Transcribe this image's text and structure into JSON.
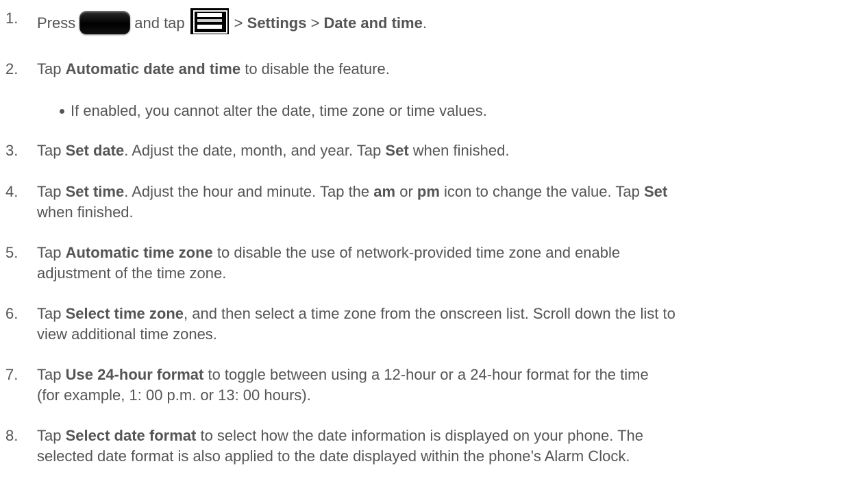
{
  "steps": [
    {
      "num": "1.",
      "t1": "Press",
      "t2": "and tap",
      "t3": ">",
      "b1": "Settings",
      "t4": ">",
      "b2": "Date and time",
      "t5": "."
    },
    {
      "num": "2.",
      "t1": "Tap",
      "b1": "Automatic date and time",
      "t2": "to disable the feature."
    },
    {
      "num": "3.",
      "t1": "Tap",
      "b1": "Set date",
      "t2": ". Adjust the date, month, and year. Tap",
      "b2": "Set",
      "t3": "when finished."
    },
    {
      "num": "4.",
      "t1": "Tap",
      "b1": "Set time",
      "t2": ". Adjust the hour and minute. Tap the",
      "b2": "am",
      "t3": "or",
      "b3": "pm",
      "t4": "icon to change the value. Tap",
      "b4": "Set",
      "t5": "when finished."
    },
    {
      "num": "5.",
      "t1": "Tap",
      "b1": "Automatic time zone",
      "t2": "to disable the use of network-provided time zone and enable",
      "t3": "adjustment of the time zone."
    },
    {
      "num": "6.",
      "t1": "Tap",
      "b1": "Select time zone",
      "t2": ", and then select a time zone from the onscreen list. Scroll down the list to",
      "t3": "view additional time zones."
    },
    {
      "num": "7.",
      "t1": "Tap",
      "b1": "Use 24-hour format",
      "t2": "to toggle between using a 12-hour or a 24-hour format for the time",
      "t3": "(for example, 1: 00 p.m. or 13: 00 hours)."
    },
    {
      "num": "8.",
      "t1": "Tap",
      "b1": "Select date format",
      "t2": "to select how the date information is displayed on your phone. The",
      "t3": "selected date format is also applied to the date displayed within the phone’s Alarm Clock."
    }
  ],
  "bullet": "If enabled, you cannot alter the date, time zone or time values.",
  "icons": {
    "home_key": "home-key-icon",
    "menu_key": "menu-key-icon"
  }
}
